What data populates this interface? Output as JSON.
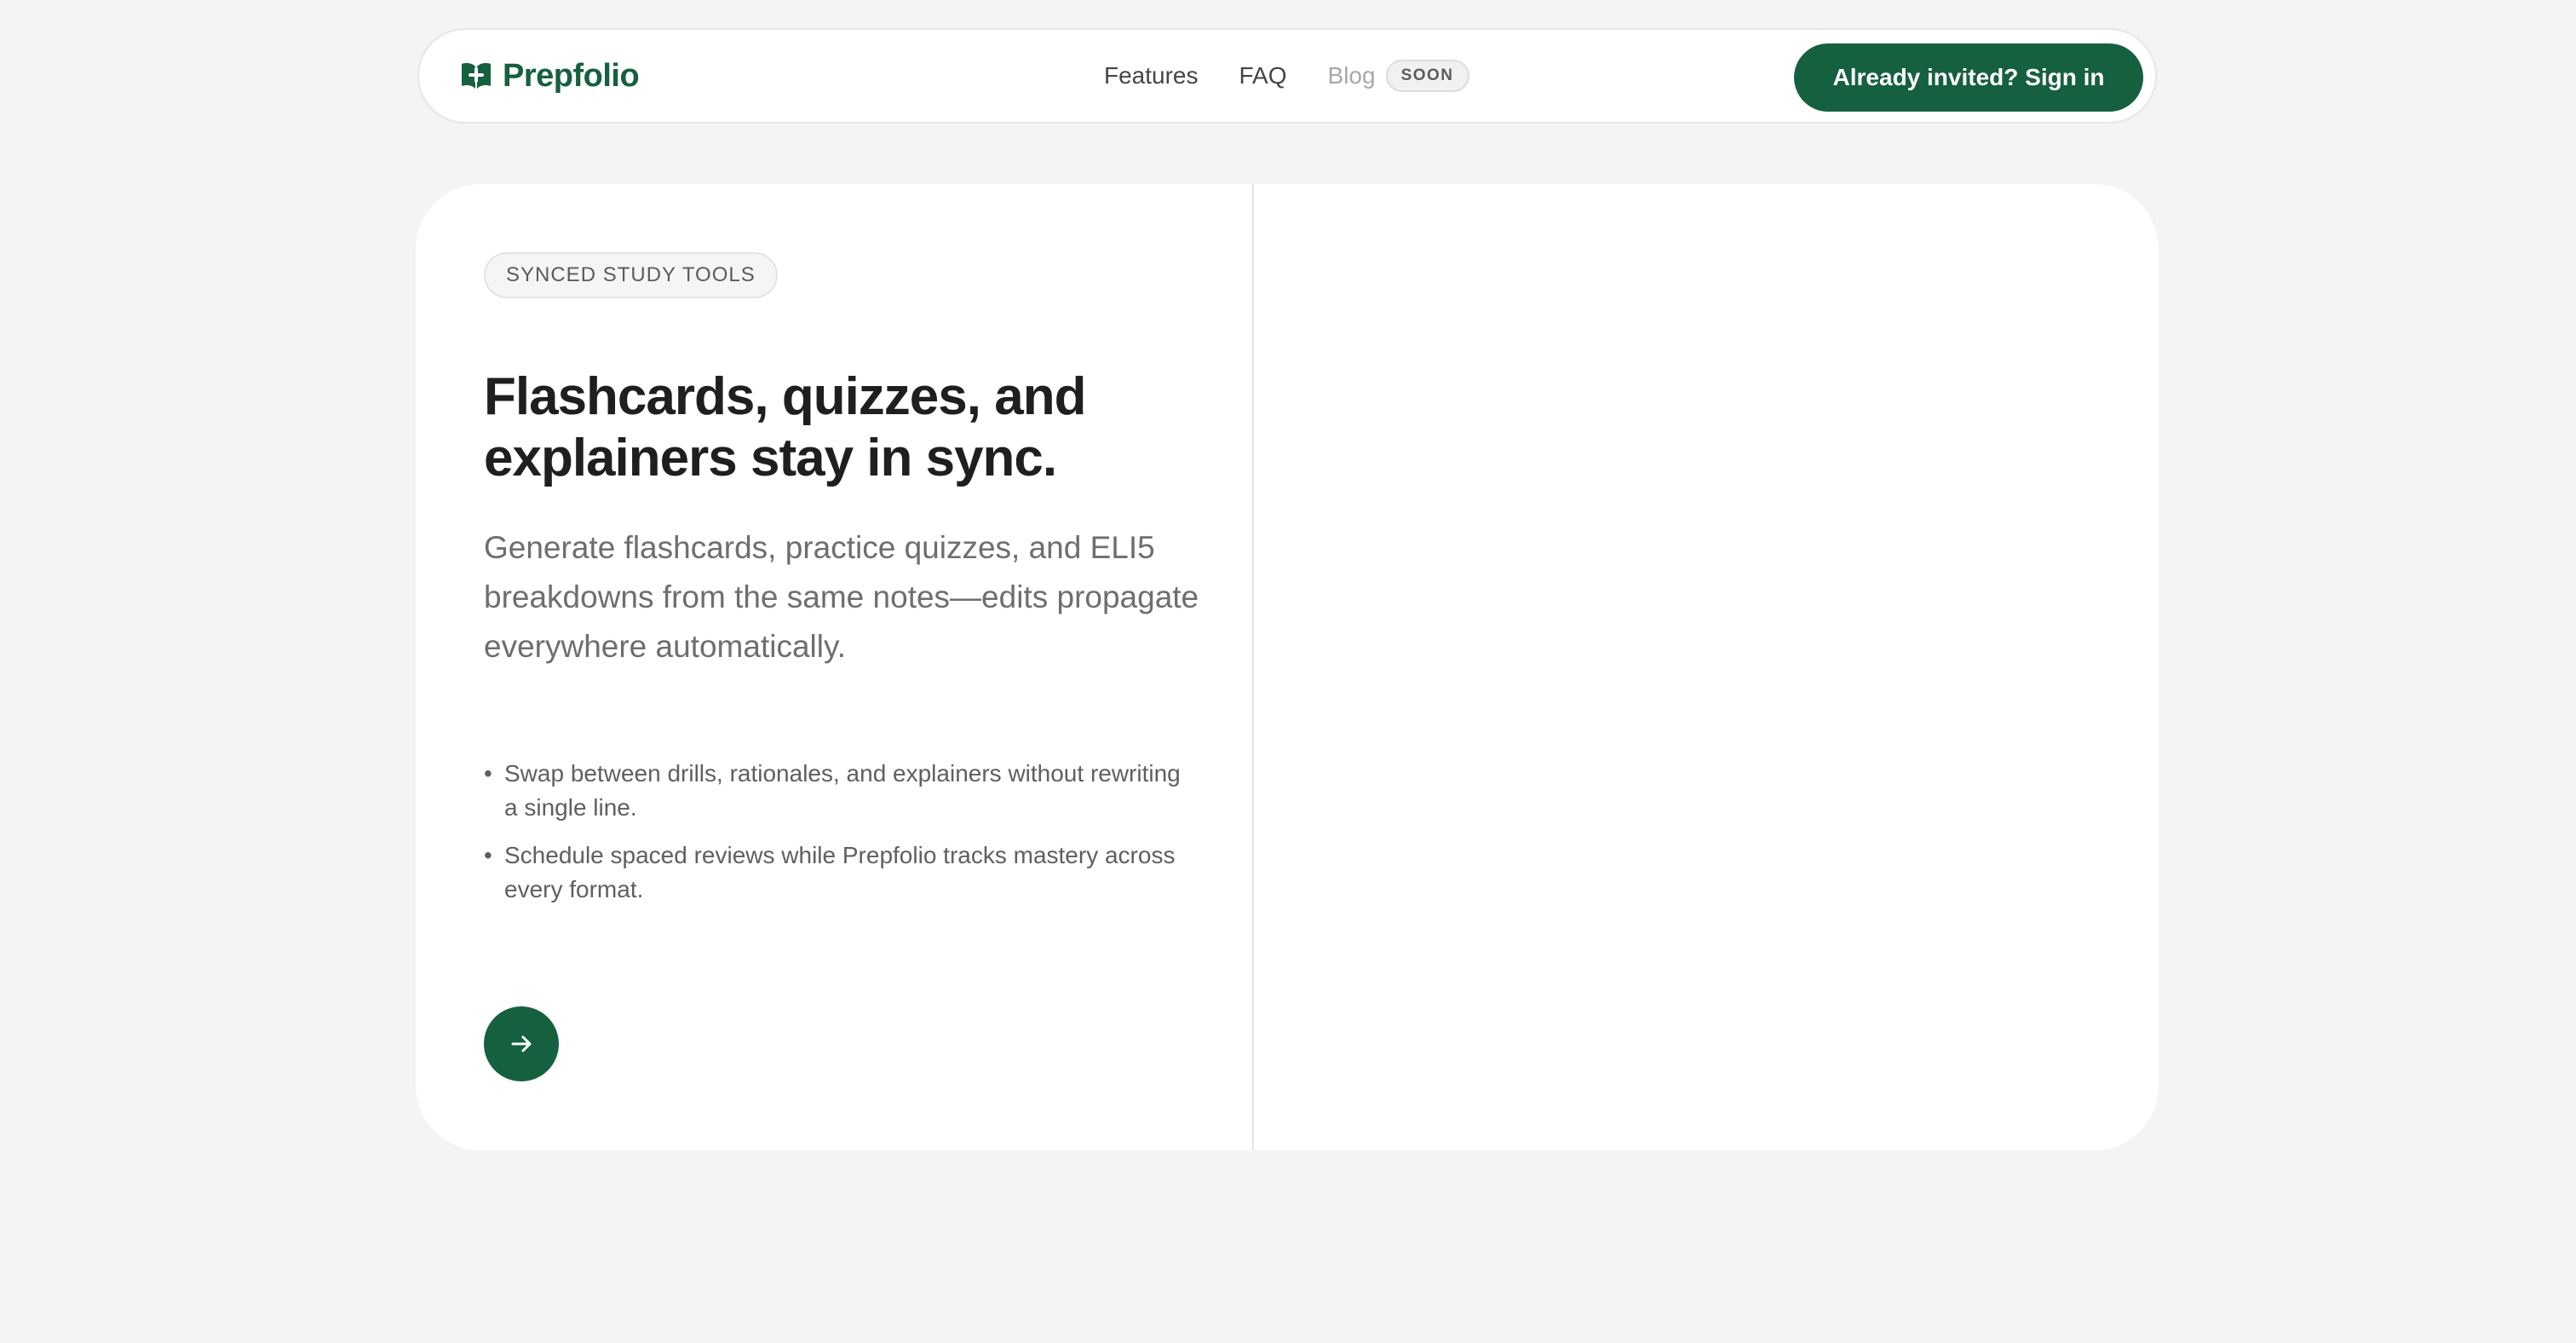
{
  "colors": {
    "brand_green": "#15603f",
    "page_background": "#f4f4f4"
  },
  "navbar": {
    "brand": {
      "icon": "book-icon",
      "name": "Prepfolio"
    },
    "links": [
      {
        "label": "Features"
      },
      {
        "label": "FAQ"
      }
    ],
    "blog": {
      "label": "Blog",
      "badge": "SOON"
    },
    "signin_label": "Already invited? Sign in"
  },
  "hero": {
    "eyebrow": "SYNCED STUDY TOOLS",
    "title": "Flashcards, quizzes, and explainers stay in sync.",
    "subtitle": "Generate flashcards, practice quizzes, and ELI5 breakdowns from the same notes—edits propagate everywhere automatically.",
    "bullets": [
      {
        "text": "Swap between drills, rationales, and explainers without rewriting a single line."
      },
      {
        "text": "Schedule spaced reviews while Prepfolio tracks mastery across every format."
      }
    ],
    "cta_icon": "arrow-right-icon"
  }
}
